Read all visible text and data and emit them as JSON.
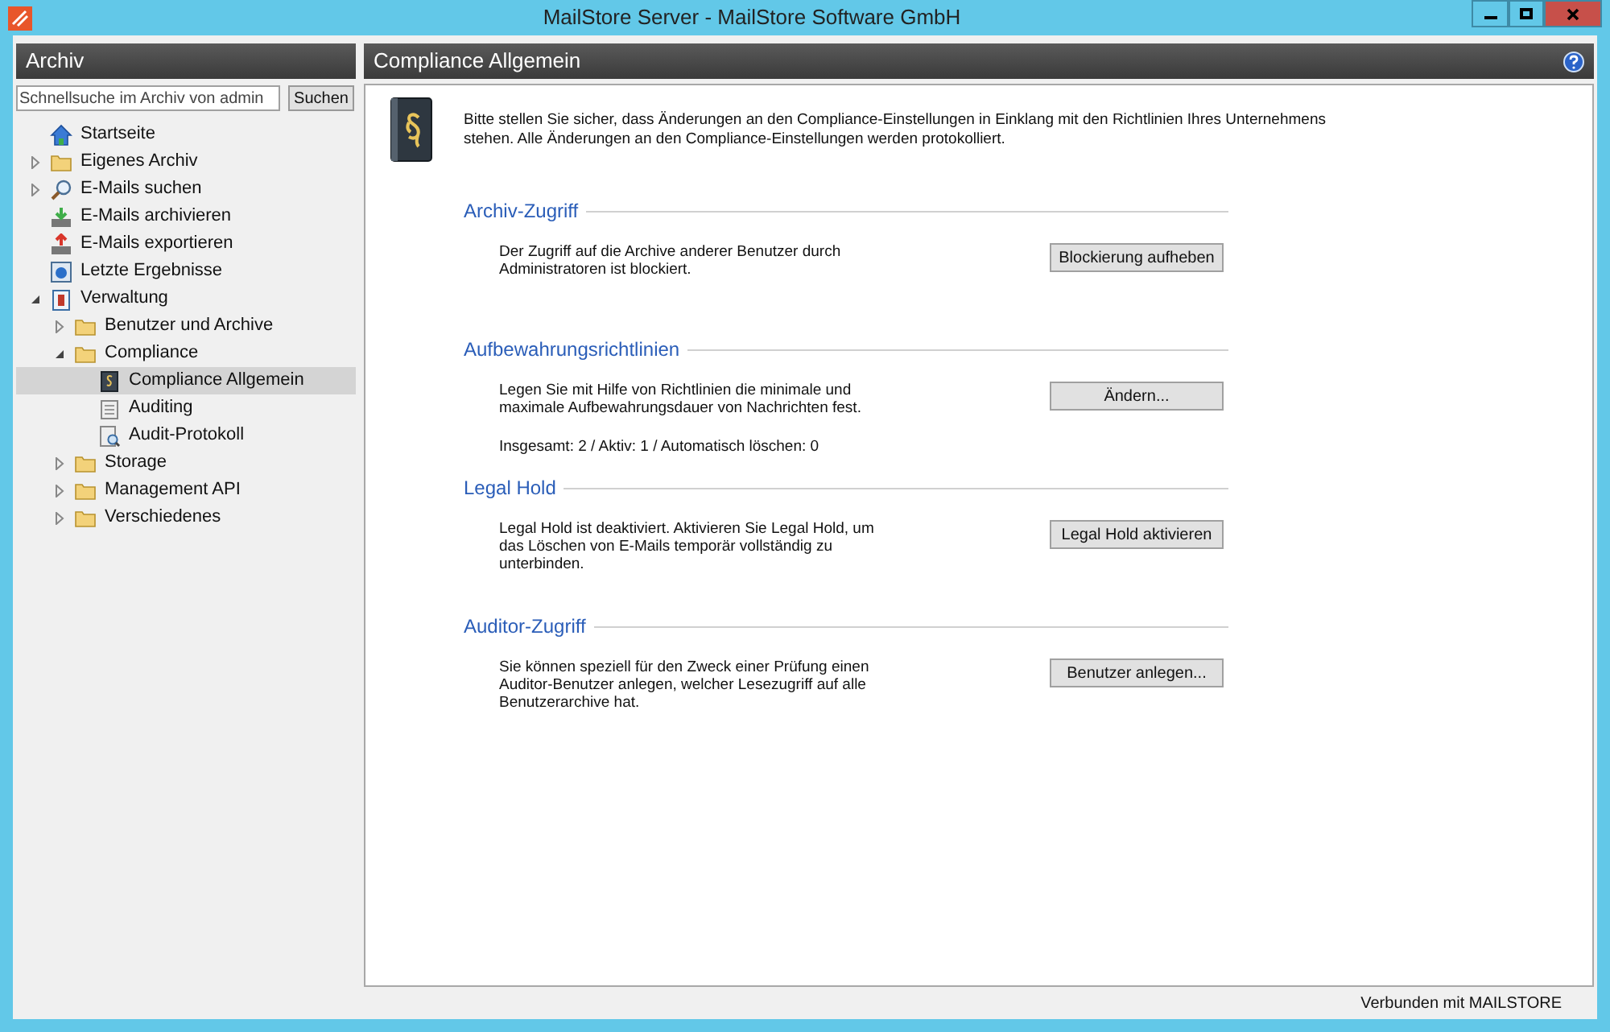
{
  "window": {
    "title": "MailStore Server - MailStore Software GmbH"
  },
  "sidebar": {
    "title": "Archiv",
    "search": {
      "placeholder": "Schnellsuche im Archiv von admin",
      "button": "Suchen"
    },
    "items": [
      {
        "label": "Startseite",
        "kind": "home",
        "selected": false
      },
      {
        "label": "Eigenes Archiv",
        "kind": "folder",
        "expanded": false,
        "selected": false
      },
      {
        "label": "E-Mails suchen",
        "kind": "search",
        "expanded": false,
        "selected": false
      },
      {
        "label": "E-Mails archivieren",
        "kind": "archive",
        "selected": false
      },
      {
        "label": "E-Mails exportieren",
        "kind": "export",
        "selected": false
      },
      {
        "label": "Letzte Ergebnisse",
        "kind": "results",
        "selected": false
      },
      {
        "label": "Verwaltung",
        "kind": "admin",
        "expanded": true,
        "selected": false,
        "children": [
          {
            "label": "Benutzer und Archive",
            "kind": "folder",
            "expanded": false,
            "selected": false
          },
          {
            "label": "Compliance",
            "kind": "folder",
            "expanded": true,
            "selected": false,
            "children": [
              {
                "label": "Compliance Allgemein",
                "kind": "book",
                "selected": true
              },
              {
                "label": "Auditing",
                "kind": "auditing",
                "selected": false
              },
              {
                "label": "Audit-Protokoll",
                "kind": "auditlog",
                "selected": false
              }
            ]
          },
          {
            "label": "Storage",
            "kind": "folder",
            "expanded": false,
            "selected": false
          },
          {
            "label": "Management API",
            "kind": "folder",
            "expanded": false,
            "selected": false
          },
          {
            "label": "Verschiedenes",
            "kind": "folder",
            "expanded": false,
            "selected": false
          }
        ]
      }
    ]
  },
  "main": {
    "title": "Compliance Allgemein",
    "intro": "Bitte stellen Sie sicher, dass Änderungen an den Compliance-Einstellungen in Einklang mit den Richtlinien Ihres Unternehmens stehen. Alle Änderungen an den Compliance-Einstellungen werden protokolliert.",
    "sections": [
      {
        "heading": "Archiv-Zugriff",
        "text": "Der Zugriff auf die Archive anderer Benutzer durch Administratoren ist blockiert.",
        "button": "Blockierung aufheben"
      },
      {
        "heading": "Aufbewahrungsrichtlinien",
        "text": "Legen Sie mit Hilfe von Richtlinien die minimale und maximale Aufbewahrungsdauer von Nachrichten fest.",
        "button": "Ändern...",
        "summary": "Insgesamt: 2 / Aktiv: 1 / Automatisch löschen: 0"
      },
      {
        "heading": "Legal Hold",
        "text": "Legal Hold ist deaktiviert. Aktivieren Sie Legal Hold, um das Löschen von E-Mails temporär vollständig zu unterbinden.",
        "button": "Legal Hold aktivieren"
      },
      {
        "heading": "Auditor-Zugriff",
        "text": "Sie können speziell für den Zweck einer Prüfung einen Auditor-Benutzer anlegen, welcher Lesezugriff auf alle Benutzerarchive hat.",
        "button": "Benutzer anlegen..."
      }
    ]
  },
  "status_bar": {
    "text": "Verbunden mit MAILSTORE"
  }
}
